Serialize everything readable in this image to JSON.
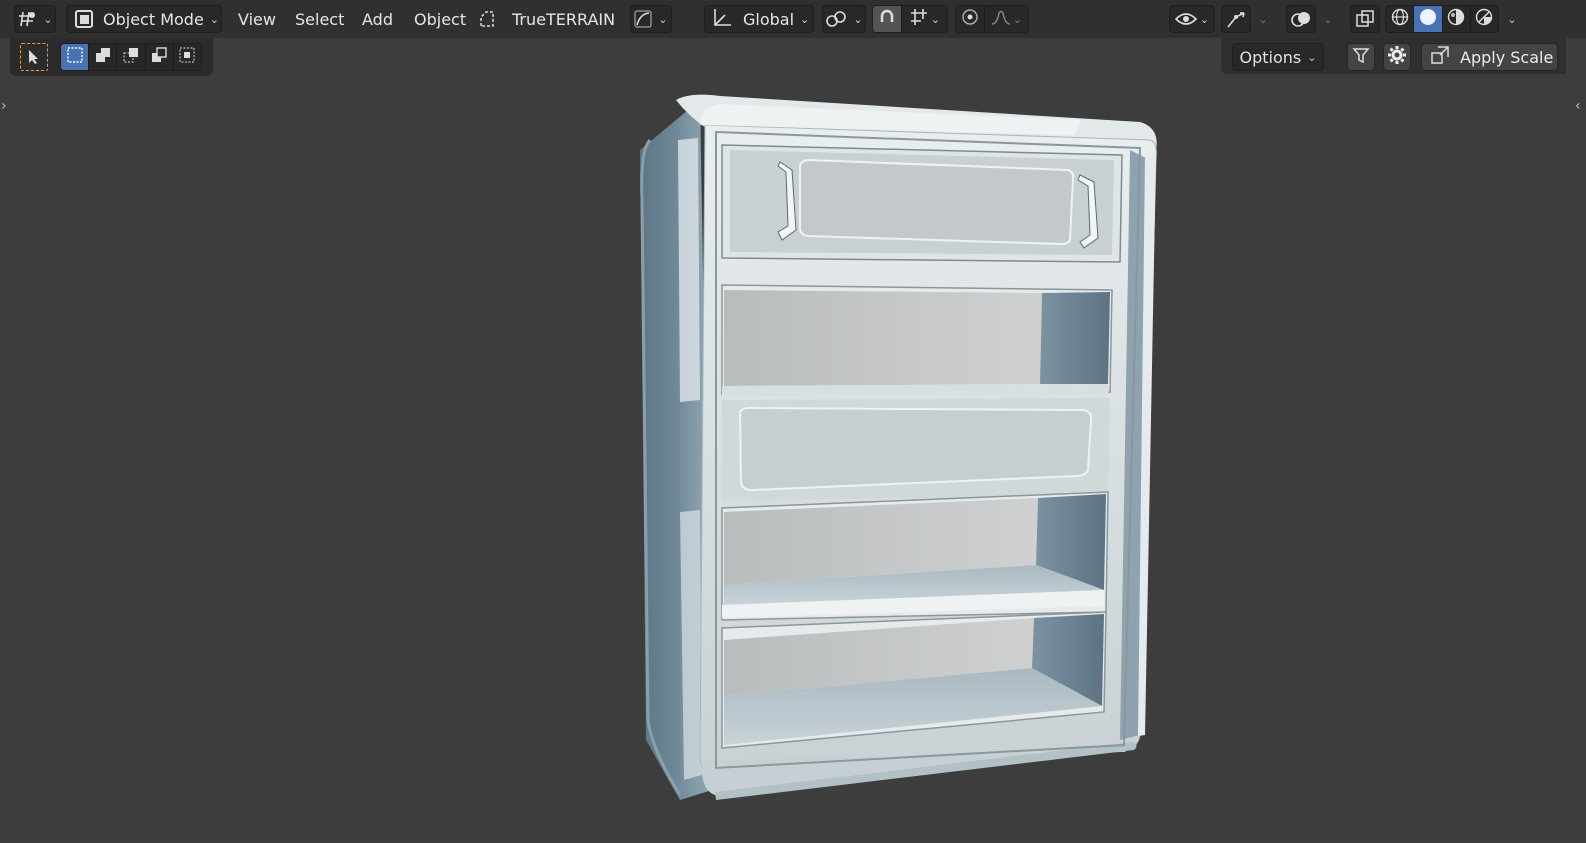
{
  "header": {
    "editor_type_icon": "3d-viewport-icon",
    "mode": "Object Mode",
    "menus": [
      "View",
      "Select",
      "Add",
      "Object"
    ],
    "addon_label": "TrueTERRAIN",
    "transform_orientation": "Global"
  },
  "tool_header": {
    "options_label": "Options",
    "apply_scale_label": "Apply Scale"
  },
  "colors": {
    "header_bg": "#303030",
    "viewport_bg": "#3d3d3d",
    "accent": "#4772b3",
    "select_tool": "#e8a13a"
  },
  "viewport": {
    "object": "cabinet-model"
  }
}
